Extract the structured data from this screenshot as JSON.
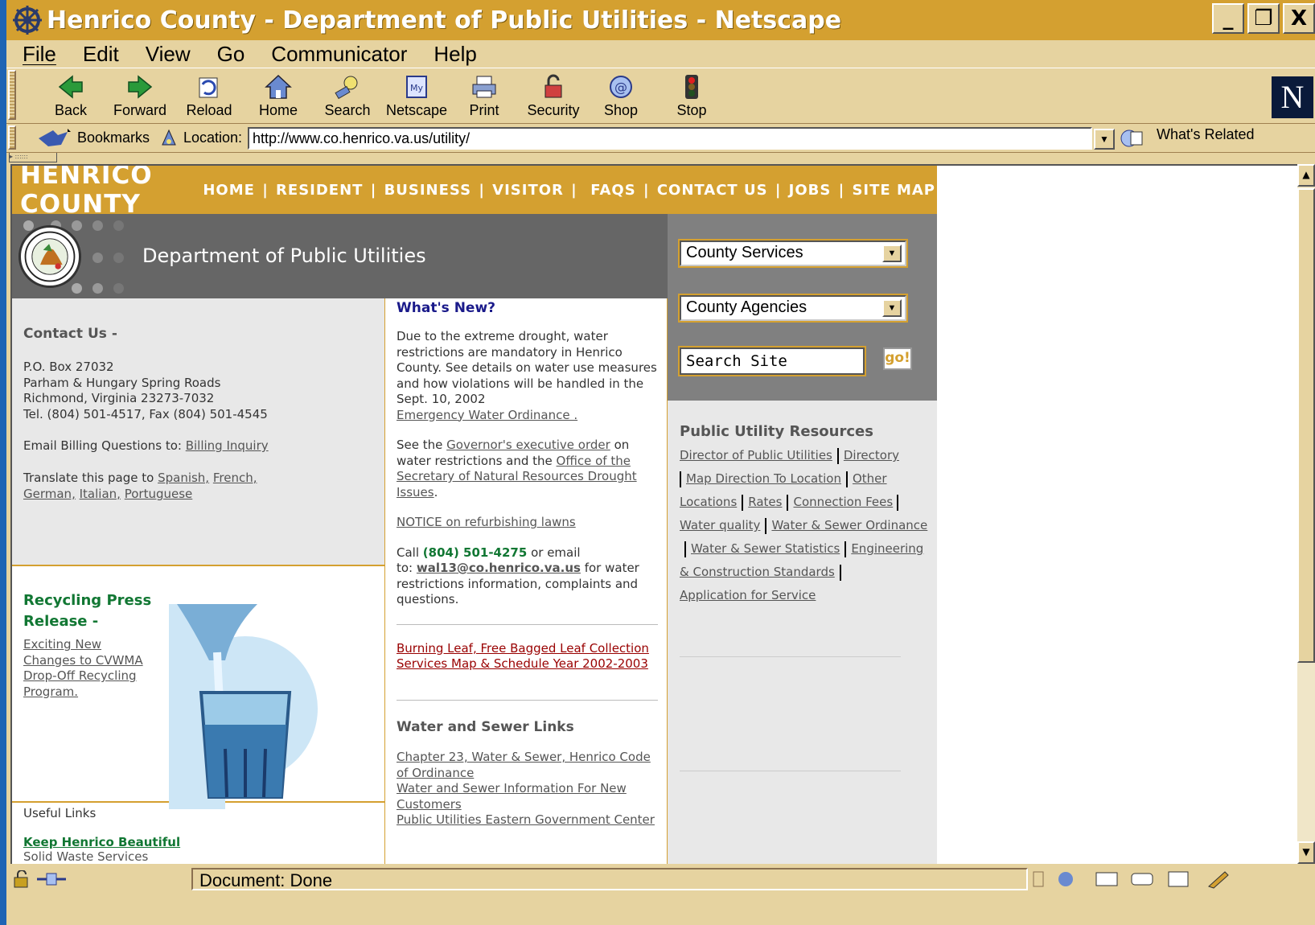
{
  "window": {
    "title": "Henrico County - Department of Public Utilities - Netscape",
    "buttons": [
      "_",
      "❐",
      "X"
    ]
  },
  "menu": [
    {
      "label": "File"
    },
    {
      "label": "Edit"
    },
    {
      "label": "View"
    },
    {
      "label": "Go"
    },
    {
      "label": "Communicator"
    },
    {
      "label": "Help"
    }
  ],
  "toolbar": {
    "back": "Back",
    "forward": "Forward",
    "reload": "Reload",
    "home": "Home",
    "search": "Search",
    "netscape": "Netscape",
    "print": "Print",
    "security": "Security",
    "shop": "Shop",
    "stop": "Stop"
  },
  "location": {
    "bookmarks": "Bookmarks",
    "label": "Location:",
    "url": "http://www.co.henrico.va.us/utility/",
    "whats_related": "What's Related"
  },
  "status": {
    "text": "Document: Done"
  },
  "page": {
    "brand": "HENRICO COUNTY",
    "nav": [
      "HOME",
      "RESIDENT",
      "BUSINESS",
      "VISITOR",
      "FAQS",
      "CONTACT US",
      "JOBS",
      "SITE MAP"
    ],
    "dept_title": "Department of Public Utilities",
    "select_services": "County Services",
    "select_agencies": "County Agencies",
    "search_value": "Search Site",
    "go": "go!",
    "contact": {
      "heading": "Contact Us -",
      "box": "P.O. Box 27032",
      "addr1": "Parham & Hungary Spring Roads",
      "addr2": "Richmond, Virginia 23273-7032",
      "tel": "Tel. (804) 501-4517, Fax (804) 501-4545",
      "email_prefix": "Email Billing Questions to: ",
      "email_link": "Billing Inquiry",
      "translate_prefix": "Translate this page to ",
      "lang_spanish": "Spanish,",
      "lang_french": "French,",
      "lang_german": "German,",
      "lang_italian": "Italian,",
      "lang_portuguese": "Portuguese"
    },
    "recycling": {
      "title1": "Recycling Press",
      "title2": "Release -",
      "link1": "Exciting New",
      "link2": "Changes to CVWMA",
      "link3": "Drop-Off Recycling",
      "link4": "Program."
    },
    "useful": {
      "heading": "Useful Links",
      "link1": "Keep Henrico Beautiful",
      "text2": "Solid Waste Services"
    },
    "whats_new": {
      "heading": "What's New?",
      "p1_a": "Due to the extreme drought, water restrictions are mandatory in Henrico County. See details on water use measures and how violations will be handled in the Sept. 10, 2002",
      "p1_link": "Emergency Water Ordinance .",
      "p2_a": "See the ",
      "p2_link1": "Governor's executive order",
      "p2_b": " on water restrictions and the ",
      "p2_link2": "Office of the Secretary of Natural Resources Drought Issues",
      "p2_c": ".",
      "notice": "NOTICE on refurbishing lawns",
      "call_a": "Call ",
      "call_phone": "(804) 501-4275",
      "call_b": " or email",
      "call_to": " to: ",
      "call_email": "wal13@co.henrico.va.us",
      "call_c": " for water restrictions information, complaints and questions.",
      "leaf_link": "Burning Leaf, Free Bagged  Leaf Collection Services  Map & Schedule Year 2002-2003"
    },
    "water_sewer": {
      "heading": "Water and Sewer Links",
      "link1": "Chapter 23, Water & Sewer, Henrico Code of Ordinance ",
      "link2": "Water and Sewer Information For New Customers ",
      "link3": "Public Utilities Eastern Government Center"
    },
    "resources": {
      "heading": "Public Utility Resources",
      "links": [
        "Director of Public Utilities",
        "Directory",
        "Map Direction To Location",
        "Other Locations",
        "Rates",
        "Connection Fees",
        "Water quality",
        "Water & Sewer Ordinance",
        "Water & Sewer Statistics",
        "Engineering & Construction Standards",
        "Application for Service"
      ]
    }
  },
  "colors": {
    "title_bar": "#d4a030",
    "chrome": "#e6d3a0",
    "desktop": "#1e64b4",
    "gray_band": "#666666",
    "green_text": "#117733",
    "red_link": "#990000"
  }
}
